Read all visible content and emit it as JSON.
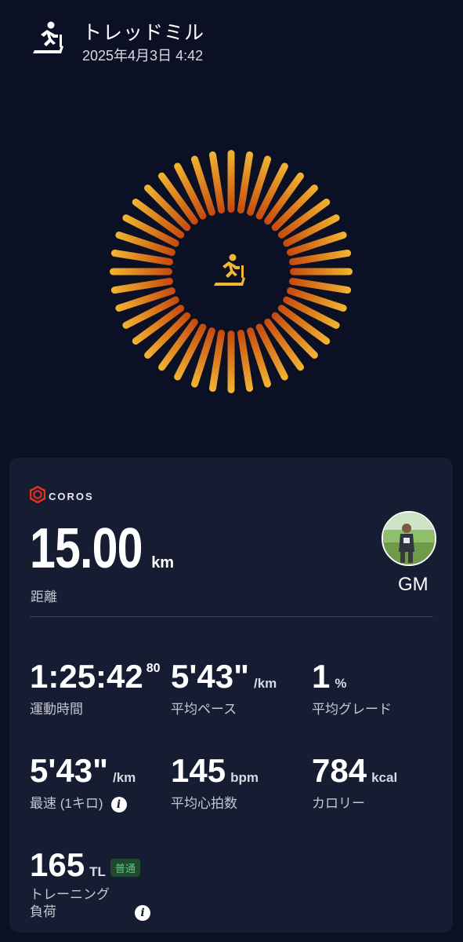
{
  "header": {
    "icon": "treadmill-icon",
    "title": "トレッドミル",
    "datetime": "2025年4月3日 4:42"
  },
  "hero": {
    "icon": "treadmill-icon",
    "colors": {
      "outer": "#f2b632",
      "inner": "#c2410c"
    }
  },
  "card": {
    "brand": {
      "icon": "coros-logo-icon",
      "text": "COROS"
    },
    "distance": {
      "value": "15.00",
      "unit": "km",
      "label": "距離"
    },
    "user": {
      "name": "GM"
    },
    "metrics": [
      {
        "value": "1:25:42",
        "sup": "80",
        "unit": "",
        "label": "運動時間"
      },
      {
        "value": "5'43\"",
        "unit": "/km",
        "label": "平均ペース"
      },
      {
        "value": "1",
        "unit": "%",
        "label": "平均グレード"
      },
      {
        "value": "5'43\"",
        "unit": "/km",
        "label": "最速 (1キロ)",
        "info": "i"
      },
      {
        "value": "145",
        "unit": "bpm",
        "label": "平均心拍数"
      },
      {
        "value": "784",
        "unit": "kcal",
        "label": "カロリー"
      },
      {
        "value": "165",
        "unit": "TL",
        "badge": "普通",
        "label_line1": "トレーニング",
        "label_line2": "負荷",
        "info": "i"
      }
    ]
  }
}
